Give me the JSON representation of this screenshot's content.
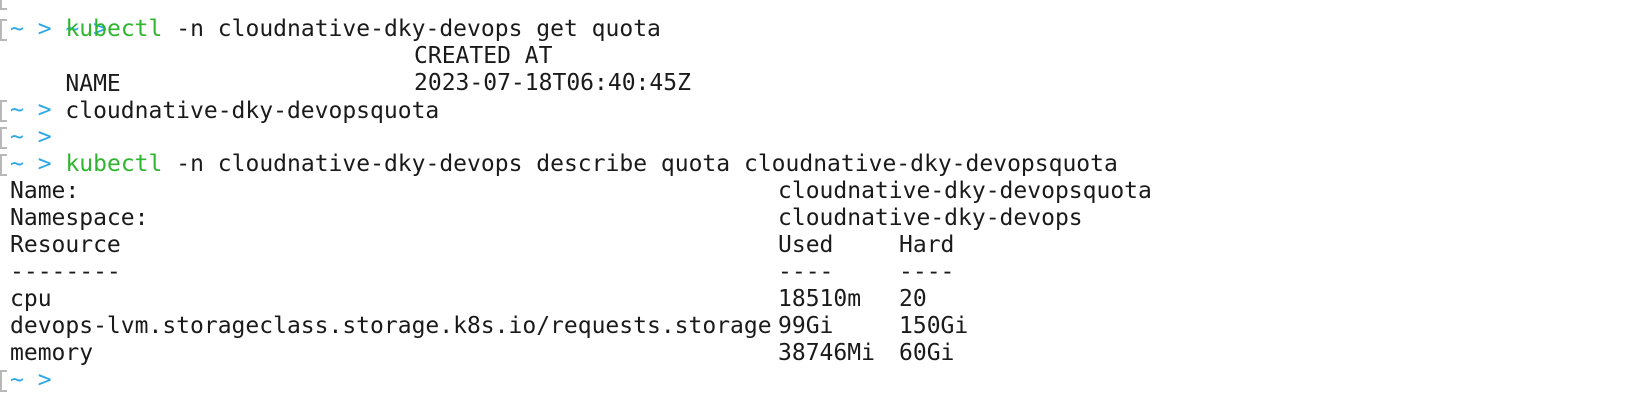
{
  "prompt": {
    "tilde": "~",
    "arrow": ">"
  },
  "lines": {
    "l0": {
      "type": "prompt"
    },
    "l1": {
      "type": "prompt",
      "cmd": "kubectl",
      "args": "-n cloudnative-dky-devops get quota"
    },
    "l2": {
      "name_header": "NAME",
      "created_header": "CREATED AT"
    },
    "l3": {
      "name": "cloudnative-dky-devopsquota",
      "created": "2023-07-18T06:40:45Z"
    },
    "l4": {
      "type": "prompt"
    },
    "l5": {
      "type": "prompt"
    },
    "l6": {
      "type": "prompt",
      "cmd": "kubectl",
      "args": "-n cloudnative-dky-devops describe quota cloudnative-dky-devopsquota"
    },
    "l7": {
      "key": "Name:",
      "value": "cloudnative-dky-devopsquota"
    },
    "l8": {
      "key": "Namespace:",
      "value": "cloudnative-dky-devops"
    },
    "l9": {
      "c1": "Resource",
      "c2": "Used",
      "c3": "Hard"
    },
    "l10": {
      "c1": "--------",
      "c2": "----",
      "c3": "----"
    },
    "rows": [
      {
        "resource": "cpu",
        "used": "18510m",
        "hard": "20"
      },
      {
        "resource": "devops-lvm.storageclass.storage.k8s.io/requests.storage",
        "used": "99Gi",
        "hard": "150Gi"
      },
      {
        "resource": "memory",
        "used": "38746Mi",
        "hard": "60Gi"
      }
    ],
    "l14": {
      "type": "prompt"
    }
  },
  "colors": {
    "prompt": "#2aa7e6",
    "command": "#2fb52f",
    "text": "#1a1a1a",
    "background": "#ffffff"
  }
}
